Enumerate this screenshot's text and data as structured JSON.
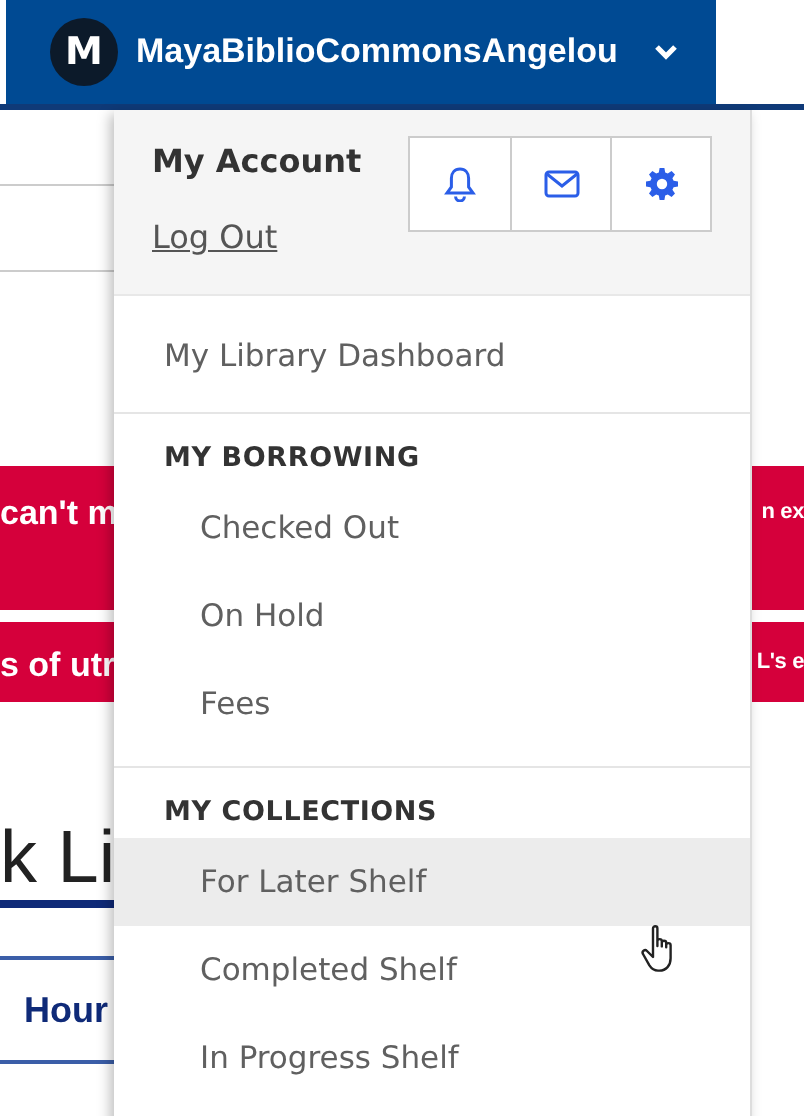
{
  "account_button": {
    "initial": "M",
    "username": "MayaBiblioCommonsAngelou"
  },
  "background": {
    "alerts": [
      {
        "left": "can't m",
        "right": "n ex"
      },
      {
        "left": "s of utr",
        "right": "L's e"
      }
    ],
    "heading": "k Li",
    "tab": "Hour"
  },
  "menu": {
    "title": "My Account",
    "logout": "Log Out",
    "dashboard": "My Library Dashboard",
    "sections": [
      {
        "heading": "MY BORROWING",
        "items": [
          {
            "label": "Checked Out",
            "highlighted": false
          },
          {
            "label": "On Hold",
            "highlighted": false
          },
          {
            "label": "Fees",
            "highlighted": false
          }
        ]
      },
      {
        "heading": "MY COLLECTIONS",
        "items": [
          {
            "label": "For Later Shelf",
            "highlighted": true
          },
          {
            "label": "Completed Shelf",
            "highlighted": false
          },
          {
            "label": "In Progress Shelf",
            "highlighted": false
          }
        ]
      }
    ]
  }
}
